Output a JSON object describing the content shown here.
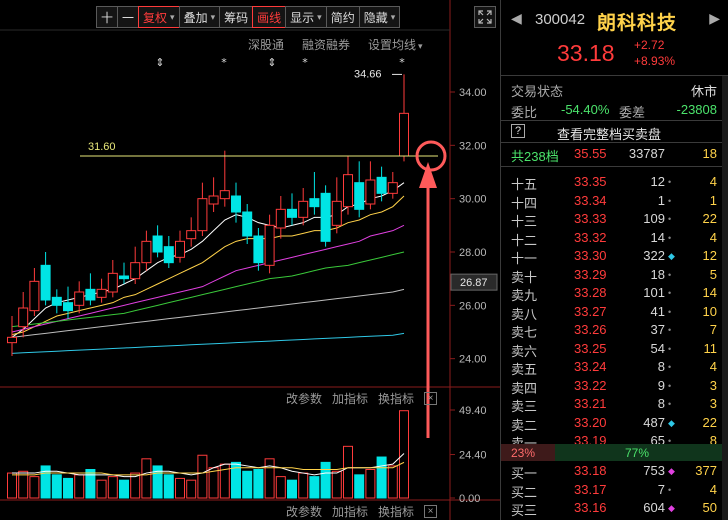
{
  "toolbar": {
    "buttons": [
      {
        "label": "十",
        "dropdown": false,
        "active": false,
        "name": "crosshair-button"
      },
      {
        "label": "一",
        "dropdown": false,
        "active": false,
        "name": "line-button"
      },
      {
        "label": "复权",
        "dropdown": true,
        "active": true,
        "name": "restore-rights-button"
      },
      {
        "label": "叠加",
        "dropdown": true,
        "active": false,
        "name": "overlay-button"
      },
      {
        "label": "筹码",
        "dropdown": false,
        "active": false,
        "name": "chips-button"
      },
      {
        "label": "画线",
        "dropdown": false,
        "active": true,
        "name": "draw-line-button"
      },
      {
        "label": "显示",
        "dropdown": true,
        "active": false,
        "name": "display-button"
      },
      {
        "label": "简约",
        "dropdown": false,
        "active": false,
        "name": "simple-button"
      },
      {
        "label": "隐藏",
        "dropdown": true,
        "active": false,
        "name": "hide-button"
      }
    ],
    "fullscreen_icon": "expand-icon"
  },
  "subtools": {
    "shenggutong": "深股通",
    "margin": "融资融券",
    "ma_settings": "设置均线"
  },
  "indicator_tools": {
    "change_params": "改参数",
    "add_indicator": "加指标",
    "switch_indicator": "换指标",
    "close": "×"
  },
  "chart_data": {
    "type": "candlestick",
    "price_axis": {
      "ticks": [
        "34.00",
        "32.00",
        "30.00",
        "28.00",
        "26.00",
        "24.00"
      ],
      "range": [
        23.2,
        35.2
      ]
    },
    "volume_axis": {
      "ticks": [
        "49.40",
        "24.40",
        "0.00"
      ],
      "range": [
        0,
        49.4
      ]
    },
    "current_price_tag": "26.87",
    "high_label": "34.66",
    "drawn_line_label": "31.60",
    "drawn_line_value": 31.6,
    "markers": [
      "⇕",
      "*",
      "⇕",
      "*",
      "*"
    ],
    "candles": [
      {
        "o": 24.6,
        "c": 24.8,
        "h": 25.6,
        "l": 24.1,
        "v": 14
      },
      {
        "o": 25.2,
        "c": 25.9,
        "h": 26.5,
        "l": 24.8,
        "v": 15
      },
      {
        "o": 25.8,
        "c": 26.9,
        "h": 27.4,
        "l": 25.6,
        "v": 12
      },
      {
        "o": 27.5,
        "c": 26.2,
        "h": 28.0,
        "l": 26.0,
        "v": 18
      },
      {
        "o": 26.3,
        "c": 26.0,
        "h": 26.6,
        "l": 25.7,
        "v": 13
      },
      {
        "o": 26.1,
        "c": 25.8,
        "h": 26.7,
        "l": 25.5,
        "v": 11
      },
      {
        "o": 26.0,
        "c": 26.5,
        "h": 26.9,
        "l": 25.7,
        "v": 13
      },
      {
        "o": 26.6,
        "c": 26.2,
        "h": 27.2,
        "l": 26.0,
        "v": 16
      },
      {
        "o": 26.3,
        "c": 26.6,
        "h": 27.0,
        "l": 26.1,
        "v": 10
      },
      {
        "o": 26.5,
        "c": 27.2,
        "h": 27.7,
        "l": 26.3,
        "v": 12
      },
      {
        "o": 27.1,
        "c": 27.0,
        "h": 27.6,
        "l": 26.8,
        "v": 10
      },
      {
        "o": 27.0,
        "c": 27.6,
        "h": 28.2,
        "l": 26.8,
        "v": 14
      },
      {
        "o": 27.6,
        "c": 28.4,
        "h": 28.8,
        "l": 27.3,
        "v": 22
      },
      {
        "o": 28.6,
        "c": 28.0,
        "h": 29.0,
        "l": 27.8,
        "v": 18
      },
      {
        "o": 28.2,
        "c": 27.6,
        "h": 28.6,
        "l": 27.4,
        "v": 13
      },
      {
        "o": 27.8,
        "c": 28.4,
        "h": 28.8,
        "l": 27.6,
        "v": 11
      },
      {
        "o": 28.5,
        "c": 28.8,
        "h": 29.3,
        "l": 28.2,
        "v": 10
      },
      {
        "o": 28.8,
        "c": 30.0,
        "h": 30.6,
        "l": 28.6,
        "v": 24
      },
      {
        "o": 29.8,
        "c": 30.1,
        "h": 30.8,
        "l": 29.5,
        "v": 17
      },
      {
        "o": 30.0,
        "c": 30.3,
        "h": 31.8,
        "l": 29.7,
        "v": 19
      },
      {
        "o": 30.1,
        "c": 29.5,
        "h": 30.6,
        "l": 29.1,
        "v": 20
      },
      {
        "o": 29.5,
        "c": 28.6,
        "h": 29.8,
        "l": 28.3,
        "v": 15
      },
      {
        "o": 28.6,
        "c": 27.6,
        "h": 28.9,
        "l": 27.3,
        "v": 16
      },
      {
        "o": 27.5,
        "c": 29.0,
        "h": 29.4,
        "l": 27.2,
        "v": 22
      },
      {
        "o": 28.9,
        "c": 29.6,
        "h": 30.1,
        "l": 28.5,
        "v": 12
      },
      {
        "o": 29.6,
        "c": 29.3,
        "h": 30.2,
        "l": 29.0,
        "v": 10
      },
      {
        "o": 29.3,
        "c": 29.9,
        "h": 30.4,
        "l": 29.0,
        "v": 14
      },
      {
        "o": 30.0,
        "c": 29.7,
        "h": 31.0,
        "l": 29.4,
        "v": 12
      },
      {
        "o": 30.2,
        "c": 28.4,
        "h": 30.5,
        "l": 28.2,
        "v": 20
      },
      {
        "o": 29.0,
        "c": 29.9,
        "h": 30.8,
        "l": 28.7,
        "v": 15
      },
      {
        "o": 29.7,
        "c": 30.9,
        "h": 31.6,
        "l": 29.4,
        "v": 29
      },
      {
        "o": 30.6,
        "c": 29.6,
        "h": 31.4,
        "l": 29.3,
        "v": 13
      },
      {
        "o": 29.8,
        "c": 30.7,
        "h": 31.4,
        "l": 29.6,
        "v": 16
      },
      {
        "o": 30.8,
        "c": 30.2,
        "h": 31.2,
        "l": 29.9,
        "v": 23
      },
      {
        "o": 30.2,
        "c": 30.6,
        "h": 31.0,
        "l": 30.0,
        "v": 18
      },
      {
        "o": 31.6,
        "c": 33.2,
        "h": 34.66,
        "l": 31.4,
        "v": 49
      }
    ],
    "ma_lines": [
      {
        "color": "#ffffff",
        "values": [
          24.8,
          25.1,
          25.5,
          25.9,
          26.1,
          26.2,
          26.3,
          26.4,
          26.5,
          26.6,
          26.8,
          27.0,
          27.3,
          27.6,
          27.8,
          27.9,
          28.1,
          28.4,
          28.8,
          29.2,
          29.4,
          29.3,
          29.1,
          29.0,
          28.9,
          29.0,
          29.1,
          29.3,
          29.3,
          29.4,
          29.7,
          29.8,
          30.0,
          30.1,
          30.3,
          30.6
        ]
      },
      {
        "color": "#ffd24a",
        "values": [
          24.9,
          25.0,
          25.2,
          25.4,
          25.6,
          25.7,
          25.8,
          25.9,
          26.0,
          26.1,
          26.3,
          26.4,
          26.6,
          26.8,
          27.0,
          27.2,
          27.4,
          27.6,
          27.9,
          28.2,
          28.4,
          28.5,
          28.5,
          28.5,
          28.6,
          28.6,
          28.7,
          28.8,
          28.8,
          28.9,
          29.1,
          29.2,
          29.4,
          29.5,
          29.7,
          30.1
        ]
      },
      {
        "color": "#e040e0",
        "values": [
          25.0,
          25.1,
          25.2,
          25.3,
          25.4,
          25.5,
          25.6,
          25.7,
          25.8,
          25.9,
          26.0,
          26.1,
          26.2,
          26.3,
          26.4,
          26.5,
          26.6,
          26.7,
          26.9,
          27.1,
          27.3,
          27.4,
          27.5,
          27.6,
          27.7,
          27.8,
          27.9,
          28.0,
          28.1,
          28.2,
          28.3,
          28.4,
          28.6,
          28.7,
          28.8,
          29.0
        ]
      },
      {
        "color": "#3ac83a",
        "values": [
          25.2,
          25.25,
          25.3,
          25.35,
          25.4,
          25.45,
          25.5,
          25.55,
          25.6,
          25.65,
          25.7,
          25.8,
          25.9,
          26.0,
          26.1,
          26.2,
          26.3,
          26.4,
          26.5,
          26.6,
          26.7,
          26.8,
          26.9,
          27.0,
          27.05,
          27.1,
          27.2,
          27.3,
          27.4,
          27.45,
          27.5,
          27.6,
          27.7,
          27.8,
          27.9,
          28.0
        ]
      },
      {
        "color": "#bcbcbc",
        "values": [
          24.8,
          24.85,
          24.9,
          24.95,
          25.0,
          25.05,
          25.1,
          25.15,
          25.2,
          25.25,
          25.3,
          25.35,
          25.4,
          25.45,
          25.5,
          25.55,
          25.6,
          25.65,
          25.7,
          25.75,
          25.8,
          25.85,
          25.9,
          25.95,
          26.0,
          26.05,
          26.1,
          26.15,
          26.2,
          26.25,
          26.3,
          26.35,
          26.4,
          26.45,
          26.5,
          26.6
        ]
      },
      {
        "color": "#2fc8e6",
        "values": [
          24.2,
          24.22,
          24.24,
          24.26,
          24.28,
          24.3,
          24.32,
          24.34,
          24.36,
          24.38,
          24.4,
          24.42,
          24.44,
          24.46,
          24.48,
          24.5,
          24.52,
          24.54,
          24.56,
          24.58,
          24.6,
          24.62,
          24.64,
          24.66,
          24.68,
          24.7,
          24.72,
          24.74,
          24.76,
          24.78,
          24.8,
          24.82,
          24.84,
          24.86,
          24.88,
          24.95
        ]
      }
    ],
    "vol_ma_lines": [
      {
        "color": "#ffffff",
        "values": [
          14,
          14,
          14,
          15,
          15,
          14,
          13,
          13,
          13,
          13,
          12,
          12,
          14,
          15,
          15,
          14,
          13,
          14,
          17,
          19,
          19,
          18,
          17,
          18,
          17,
          15,
          14,
          13,
          14,
          14,
          17,
          17,
          17,
          18,
          19,
          25
        ]
      },
      {
        "color": "#ffd24a",
        "values": [
          13,
          13,
          13,
          14,
          14,
          14,
          14,
          14,
          14,
          13,
          13,
          13,
          13,
          14,
          14,
          14,
          14,
          14,
          15,
          16,
          17,
          17,
          17,
          17,
          17,
          17,
          16,
          16,
          16,
          16,
          17,
          17,
          17,
          17,
          17,
          20
        ]
      }
    ]
  },
  "panel": {
    "code": "300042",
    "name": "朗科科技",
    "price": "33.18",
    "change": "+2.72",
    "change_pct": "+8.93%",
    "status_label": "交易状态",
    "status_value": "休市",
    "weibi_label": "委比",
    "weibi_value": "-54.40%",
    "weicha_label": "委差",
    "weicha_value": "-23808",
    "help_icon": "?",
    "full_orderbook": "查看完整档买卖盘",
    "total_levels": "共238档",
    "total_price": "35.55",
    "total_volume": "33787",
    "total_change": "18",
    "sell_ratio": "23%",
    "buy_ratio": "77%"
  },
  "order_book": {
    "asks": [
      {
        "label": "十五",
        "price": "33.35",
        "vol": "12",
        "dot": "•",
        "dotcolor": "#888888",
        "chg": "4"
      },
      {
        "label": "十四",
        "price": "33.34",
        "vol": "1",
        "dot": "•",
        "dotcolor": "#888888",
        "chg": "1"
      },
      {
        "label": "十三",
        "price": "33.33",
        "vol": "109",
        "dot": "•",
        "dotcolor": "#888888",
        "chg": "22"
      },
      {
        "label": "十二",
        "price": "33.32",
        "vol": "14",
        "dot": "•",
        "dotcolor": "#888888",
        "chg": "4"
      },
      {
        "label": "十一",
        "price": "33.30",
        "vol": "322",
        "dot": "◆",
        "dotcolor": "#2fc8e6",
        "chg": "12"
      },
      {
        "label": "卖十",
        "price": "33.29",
        "vol": "18",
        "dot": "•",
        "dotcolor": "#888888",
        "chg": "5"
      },
      {
        "label": "卖九",
        "price": "33.28",
        "vol": "101",
        "dot": "•",
        "dotcolor": "#888888",
        "chg": "14"
      },
      {
        "label": "卖八",
        "price": "33.27",
        "vol": "41",
        "dot": "•",
        "dotcolor": "#888888",
        "chg": "10"
      },
      {
        "label": "卖七",
        "price": "33.26",
        "vol": "37",
        "dot": "•",
        "dotcolor": "#888888",
        "chg": "7"
      },
      {
        "label": "卖六",
        "price": "33.25",
        "vol": "54",
        "dot": "•",
        "dotcolor": "#888888",
        "chg": "11"
      },
      {
        "label": "卖五",
        "price": "33.24",
        "vol": "8",
        "dot": "•",
        "dotcolor": "#888888",
        "chg": "4"
      },
      {
        "label": "卖四",
        "price": "33.22",
        "vol": "9",
        "dot": "•",
        "dotcolor": "#888888",
        "chg": "3"
      },
      {
        "label": "卖三",
        "price": "33.21",
        "vol": "8",
        "dot": "•",
        "dotcolor": "#888888",
        "chg": "3"
      },
      {
        "label": "卖二",
        "price": "33.20",
        "vol": "487",
        "dot": "◆",
        "dotcolor": "#2fc8e6",
        "chg": "22"
      },
      {
        "label": "卖一",
        "price": "33.19",
        "vol": "65",
        "dot": "•",
        "dotcolor": "#888888",
        "chg": "8"
      }
    ],
    "bids": [
      {
        "label": "买一",
        "price": "33.18",
        "vol": "753",
        "dot": "◆",
        "dotcolor": "#e040e0",
        "chg": "377"
      },
      {
        "label": "买二",
        "price": "33.17",
        "vol": "7",
        "dot": "•",
        "dotcolor": "#888888",
        "chg": "4"
      },
      {
        "label": "买三",
        "price": "33.16",
        "vol": "604",
        "dot": "◆",
        "dotcolor": "#e040e0",
        "chg": "50"
      }
    ]
  }
}
